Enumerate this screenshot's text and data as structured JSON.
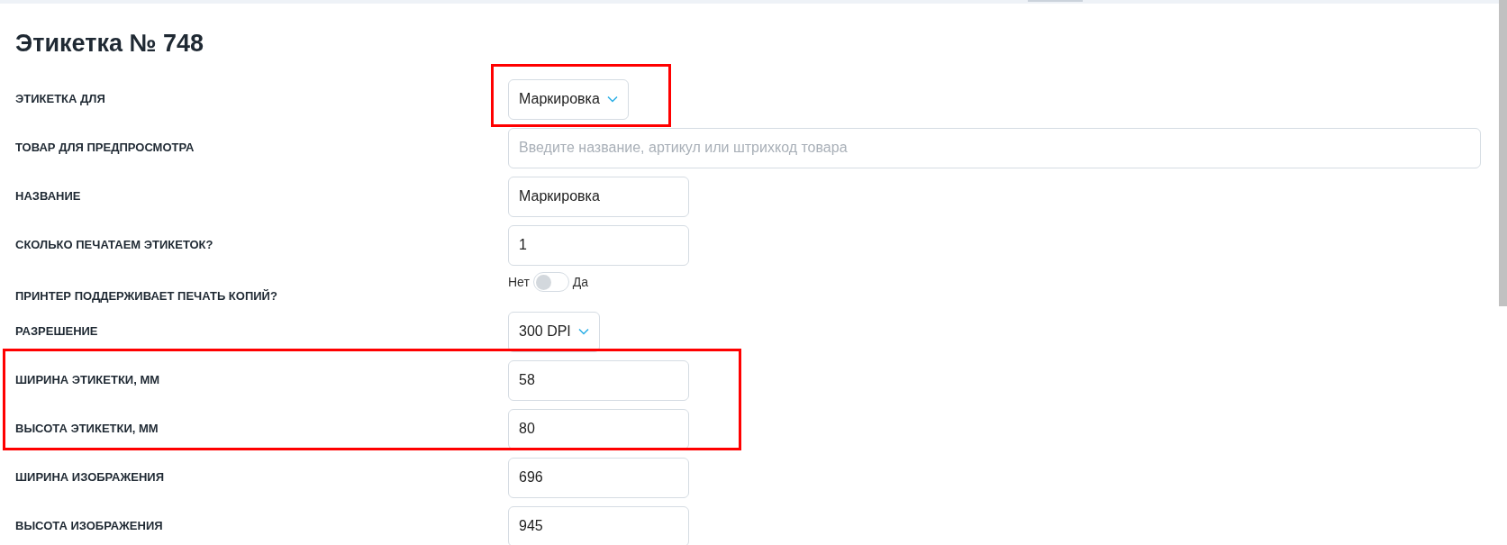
{
  "title": "Этикетка № 748",
  "fields": [
    {
      "kind": "select",
      "label": "ЭТИКЕТКА ДЛЯ",
      "value": "Маркировка"
    },
    {
      "kind": "search",
      "label": "ТОВАР ДЛЯ ПРЕДПРОСМОТРА",
      "placeholder": "Введите название, артикул или штрихкод товара"
    },
    {
      "kind": "input",
      "label": "НАЗВАНИЕ",
      "value": "Маркировка"
    },
    {
      "kind": "input",
      "label": "СКОЛЬКО ПЕЧАТАЕМ ЭТИКЕТОК?",
      "value": "1"
    },
    {
      "kind": "toggle",
      "label": "ПРИНТЕР ПОДДЕРЖИВАЕТ ПЕЧАТЬ КОПИЙ?",
      "off_label": "Нет",
      "on_label": "Да",
      "on": false
    },
    {
      "kind": "select",
      "label": "РАЗРЕШЕНИЕ",
      "value": "300 DPI"
    },
    {
      "kind": "input",
      "label": "ШИРИНА ЭТИКЕТКИ, ММ",
      "value": "58"
    },
    {
      "kind": "input",
      "label": "ВЫСОТА ЭТИКЕТКИ, ММ",
      "value": "80"
    },
    {
      "kind": "input",
      "label": "ШИРИНА ИЗОБРАЖЕНИЯ",
      "value": "696"
    },
    {
      "kind": "input",
      "label": "ВЫСОТА ИЗОБРАЖЕНИЯ",
      "value": "945"
    }
  ]
}
